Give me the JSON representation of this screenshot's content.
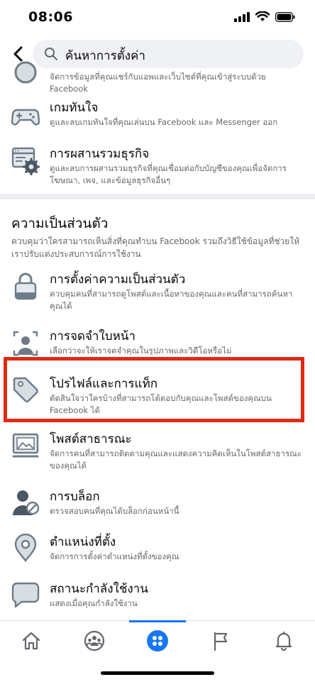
{
  "status_bar": {
    "time": "08:06"
  },
  "search": {
    "value": "ค้นหาการตั้งค่า"
  },
  "top_items": [
    {
      "description": "จัดการข้อมูลที่คุณแชร์กับแอพและเว็บไซต์ที่คุณเข้าสู่ระบบด้วย Facebook"
    },
    {
      "title": "เกมทันใจ",
      "description": "ดูและลบเกมทันใจที่คุณเล่นบน Facebook และ Messenger ออก"
    },
    {
      "title": "การผสานรวมธุรกิจ",
      "description": "ดูและลบการผสานรวมธุรกิจที่คุณเชื่อมต่อกับบัญชีของคุณเพื่อจัดการโฆษณา, เพจ, และข้อมูลธุรกิจอื่นๆ"
    }
  ],
  "privacy_section": {
    "title": "ความเป็นส่วนตัว",
    "description": "ควบคุมว่าใครสามารถเห็นสิ่งที่คุณทำบน Facebook รวมถึงวิธีใช้ข้อมูลที่ช่วยให้เราปรับแต่งประสบการณ์การใช้งาน",
    "items": [
      {
        "title": "การตั้งค่าความเป็นส่วนตัว",
        "description": "ควบคุมคนที่สามารถดูโพสต์และเนื้อหาของคุณและคนที่สามารถค้นหาคุณได้"
      },
      {
        "title": "การจดจำใบหน้า",
        "description": "เลือกว่าจะให้เราจดจำคุณในรูปภาพและวิดีโอหรือไม่"
      },
      {
        "title": "โปรไฟล์และการแท็ก",
        "description": "ตัดสินใจว่าใครบ้างที่สามารถโต้ตอบกับคุณและโพสต์ของคุณบน Facebook ได้"
      },
      {
        "title": "โพสต์สาธารณะ",
        "description": "จัดการคนที่สามารถติดตามคุณและแสดงความคิดเห็นในโพสต์สาธารณะของคุณได้"
      },
      {
        "title": "การบล็อก",
        "description": "ตรวจสอบคนที่คุณได้บล็อกก่อนหน้านี้"
      },
      {
        "title": "ตำแหน่งที่ตั้ง",
        "description": "จัดการการตั้งค่าตำแหน่งที่ตั้งของคุณ"
      },
      {
        "title": "สถานะกำลังใช้งาน",
        "description": "แสดงเมื่อคุณกำลังใช้งาน"
      }
    ]
  },
  "tab_bar": {
    "tabs": [
      "home-icon",
      "groups-icon",
      "menu-icon",
      "flag-icon",
      "bell-icon"
    ],
    "active": "menu-icon",
    "accent_color": "#1877f2"
  },
  "colors": {
    "highlight_border": "#e02a14",
    "icon_gray": "#6d7c88"
  }
}
